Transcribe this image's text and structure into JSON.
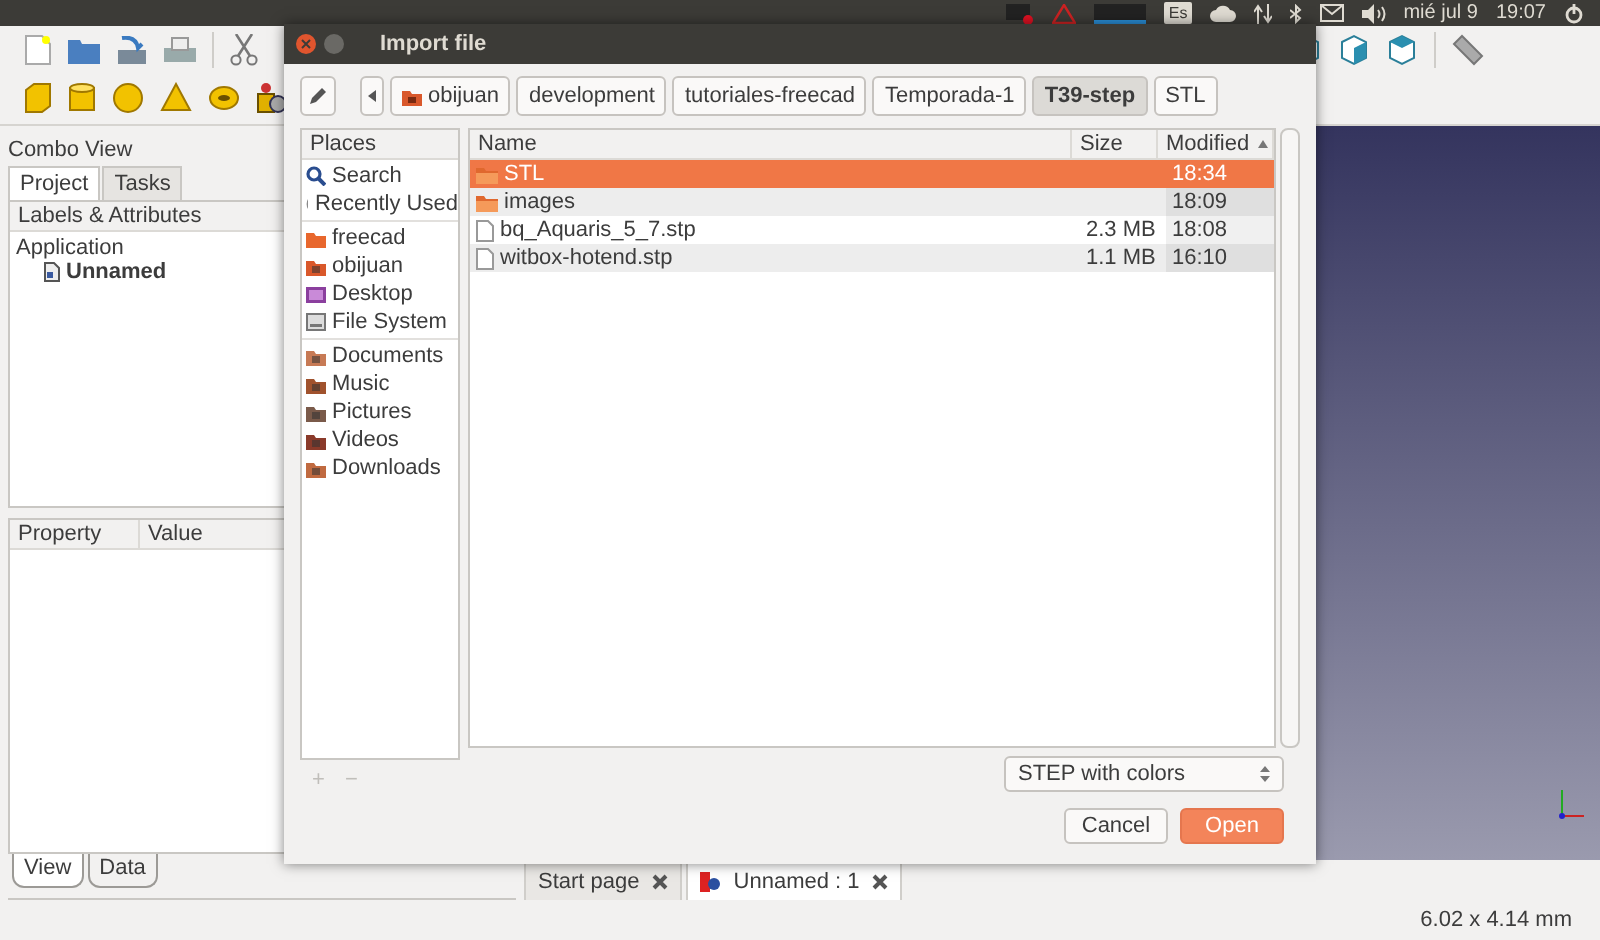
{
  "top_panel": {
    "keyboard_layout": "Es",
    "date": "mié jul 9",
    "time": "19:07"
  },
  "combo_view": {
    "title": "Combo View",
    "tabs": [
      {
        "label": "Project",
        "selected": true
      },
      {
        "label": "Tasks",
        "selected": false
      }
    ],
    "tree_header": "Labels & Attributes",
    "tree": [
      {
        "label": "Application",
        "active": false,
        "children": [
          {
            "label": "Unnamed",
            "active": true
          }
        ]
      }
    ],
    "property_columns": [
      "Property",
      "Value"
    ],
    "bottom_tabs": [
      {
        "label": "View",
        "selected": true
      },
      {
        "label": "Data",
        "selected": false
      }
    ]
  },
  "document_tabs": [
    {
      "label": "Start page",
      "selected": false
    },
    {
      "label": "Unnamed : 1",
      "selected": true
    }
  ],
  "status_bar": {
    "dimensions": "6.02 x 4.14 mm"
  },
  "dialog": {
    "title": "Import file",
    "path": [
      {
        "label": "obijuan",
        "kind": "home",
        "selected": false
      },
      {
        "label": "development",
        "kind": "folder",
        "selected": false
      },
      {
        "label": "tutoriales-freecad",
        "kind": "folder",
        "selected": false
      },
      {
        "label": "Temporada-1",
        "kind": "folder",
        "selected": false
      },
      {
        "label": "T39-step",
        "kind": "folder",
        "selected": true
      },
      {
        "label": "STL",
        "kind": "folder",
        "selected": false
      }
    ],
    "places_header": "Places",
    "places": [
      [
        {
          "label": "Search",
          "kind": "search"
        },
        {
          "label": "Recently Used",
          "kind": "recent"
        }
      ],
      [
        {
          "label": "freecad",
          "kind": "folder"
        },
        {
          "label": "obijuan",
          "kind": "home"
        },
        {
          "label": "Desktop",
          "kind": "desktop"
        },
        {
          "label": "File System",
          "kind": "drive"
        }
      ],
      [
        {
          "label": "Documents",
          "kind": "documents"
        },
        {
          "label": "Music",
          "kind": "music"
        },
        {
          "label": "Pictures",
          "kind": "pictures"
        },
        {
          "label": "Videos",
          "kind": "videos"
        },
        {
          "label": "Downloads",
          "kind": "downloads"
        }
      ]
    ],
    "place_buttons": [
      "+",
      "−"
    ],
    "columns": [
      "Name",
      "Size",
      "Modified"
    ],
    "files": [
      {
        "name": "STL",
        "kind": "folder",
        "modified": "18:34",
        "selected": true
      },
      {
        "name": "images",
        "kind": "folder",
        "modified": "18:09",
        "selected": false
      },
      {
        "name": "bq_Aquaris_5_7.stp",
        "kind": "file",
        "size": "2.3 MB",
        "modified": "18:08",
        "selected": false
      },
      {
        "name": "witbox-hotend.stp",
        "kind": "file",
        "size": "1.1 MB",
        "modified": "16:10",
        "selected": false
      }
    ],
    "filter": "STEP with colors",
    "buttons": [
      {
        "label": "Cancel",
        "kind": "normal"
      },
      {
        "label": "Open",
        "kind": "default"
      }
    ]
  }
}
